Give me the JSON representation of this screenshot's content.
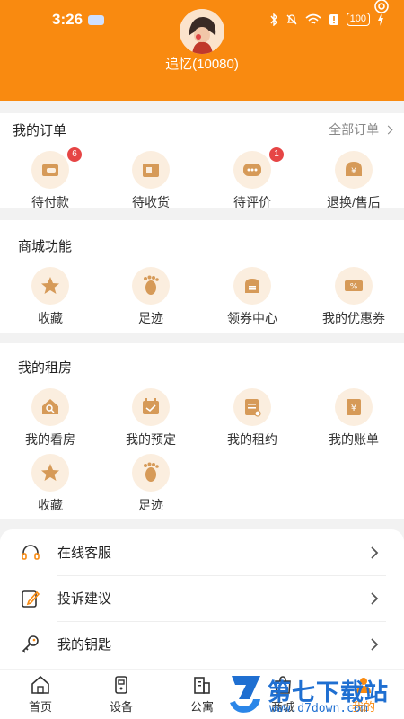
{
  "status_bar": {
    "time": "3:26",
    "battery": "100"
  },
  "profile": {
    "username": "追忆(10080)"
  },
  "orders": {
    "title": "我的订单",
    "all_link": "全部订单",
    "items": [
      {
        "label": "待付款",
        "icon": "wallet-icon",
        "badge": "6"
      },
      {
        "label": "待收货",
        "icon": "box-icon",
        "badge": ""
      },
      {
        "label": "待评价",
        "icon": "comment-icon",
        "badge": "1"
      },
      {
        "label": "退换/售后",
        "icon": "refund-icon",
        "badge": ""
      }
    ]
  },
  "mall": {
    "title": "商城功能",
    "items": [
      {
        "label": "收藏",
        "icon": "star-icon"
      },
      {
        "label": "足迹",
        "icon": "footprint-icon"
      },
      {
        "label": "领券中心",
        "icon": "coupon-center-icon"
      },
      {
        "label": "我的优惠券",
        "icon": "discount-ticket-icon"
      }
    ]
  },
  "rental": {
    "title": "我的租房",
    "items": [
      {
        "label": "我的看房",
        "icon": "house-search-icon"
      },
      {
        "label": "我的预定",
        "icon": "calendar-check-icon"
      },
      {
        "label": "我的租约",
        "icon": "contract-icon"
      },
      {
        "label": "我的账单",
        "icon": "bill-icon"
      },
      {
        "label": "收藏",
        "icon": "star-icon"
      },
      {
        "label": "足迹",
        "icon": "footprint-icon"
      }
    ]
  },
  "menu": [
    {
      "label": "在线客服",
      "icon": "headset-icon"
    },
    {
      "label": "投诉建议",
      "icon": "edit-note-icon"
    },
    {
      "label": "我的钥匙",
      "icon": "key-icon"
    }
  ],
  "tabbar": [
    {
      "label": "首页",
      "icon": "home-icon"
    },
    {
      "label": "设备",
      "icon": "device-icon"
    },
    {
      "label": "公寓",
      "icon": "apartment-icon"
    },
    {
      "label": "商城",
      "icon": "mall-icon"
    },
    {
      "label": "我的",
      "icon": "profile-icon",
      "active": true
    }
  ],
  "watermark": {
    "main": "第七下载站",
    "sub": "www.d7down.com"
  },
  "colors": {
    "brand": "#f98a10",
    "badge": "#e64545",
    "icon_bg": "#fbeedf",
    "watermark": "#1f6fd1"
  }
}
